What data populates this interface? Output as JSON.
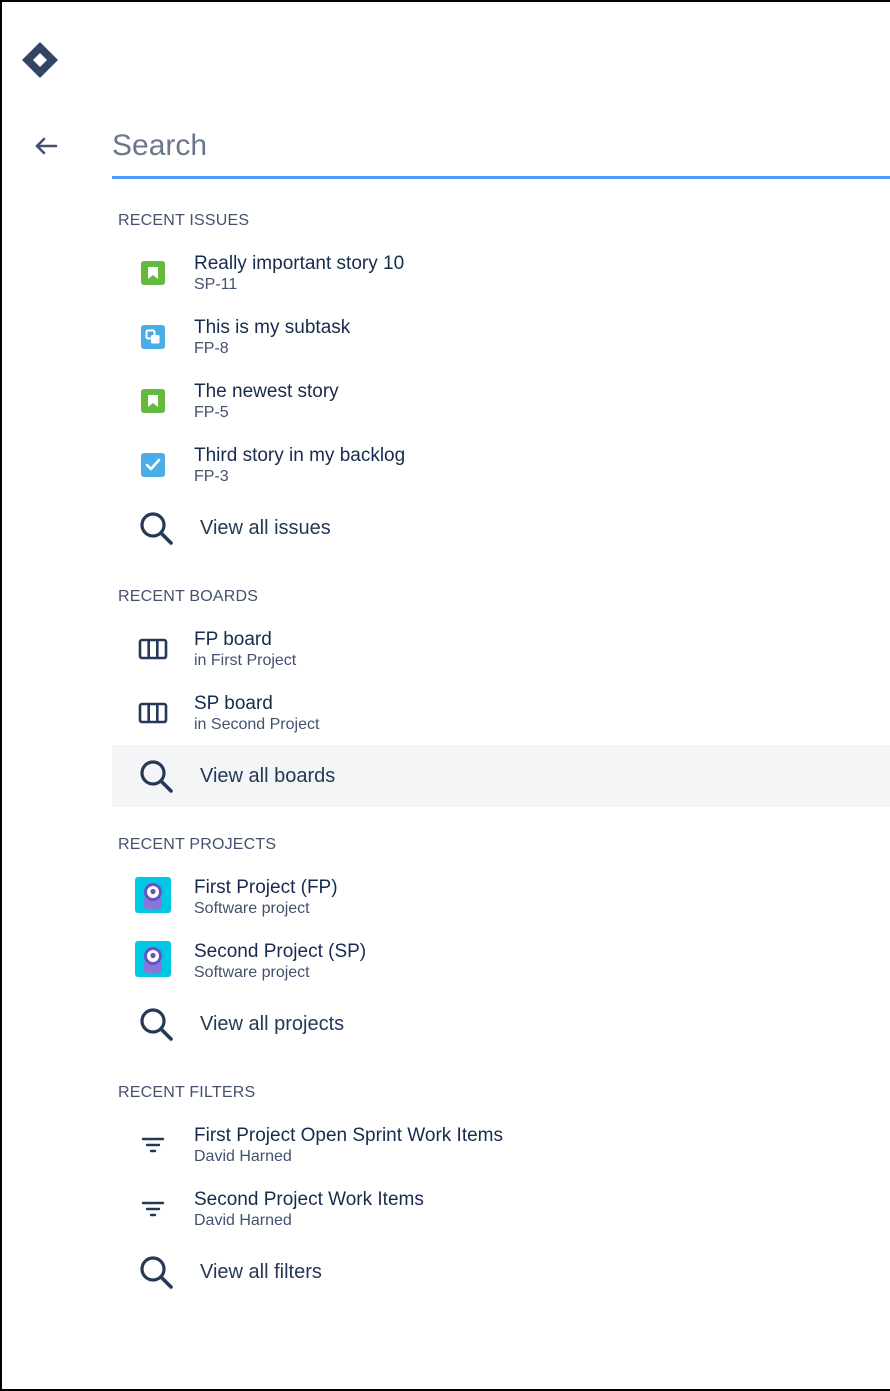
{
  "search": {
    "placeholder": "Search",
    "value": ""
  },
  "sections": {
    "issues": {
      "heading": "RECENT ISSUES",
      "items": [
        {
          "title": "Really important story 10",
          "sub": "SP-11",
          "icon": "story-icon",
          "color": "#63ba3c"
        },
        {
          "title": "This is my subtask",
          "sub": "FP-8",
          "icon": "subtask-icon",
          "color": "#4bade8"
        },
        {
          "title": "The newest story",
          "sub": "FP-5",
          "icon": "story-icon",
          "color": "#63ba3c"
        },
        {
          "title": "Third story in my backlog",
          "sub": "FP-3",
          "icon": "task-icon",
          "color": "#4bade8"
        }
      ],
      "view_all": "View all issues"
    },
    "boards": {
      "heading": "RECENT BOARDS",
      "items": [
        {
          "title": "FP board",
          "sub": "in First Project",
          "icon": "board-icon"
        },
        {
          "title": "SP board",
          "sub": "in Second Project",
          "icon": "board-icon"
        }
      ],
      "view_all": "View all boards"
    },
    "projects": {
      "heading": "RECENT PROJECTS",
      "items": [
        {
          "title": "First Project (FP)",
          "sub": "Software project",
          "icon": "project-avatar-icon"
        },
        {
          "title": "Second Project (SP)",
          "sub": "Software project",
          "icon": "project-avatar-icon"
        }
      ],
      "view_all": "View all projects"
    },
    "filters": {
      "heading": "RECENT FILTERS",
      "items": [
        {
          "title": "First Project Open Sprint Work Items",
          "sub": "David Harned",
          "icon": "filter-icon"
        },
        {
          "title": "Second Project Work Items",
          "sub": "David Harned",
          "icon": "filter-icon"
        }
      ],
      "view_all": "View all filters"
    }
  },
  "colors": {
    "accent": "#4c9aff",
    "story": "#63ba3c",
    "subtask": "#4bade8",
    "hover": "#f4f5f7"
  }
}
